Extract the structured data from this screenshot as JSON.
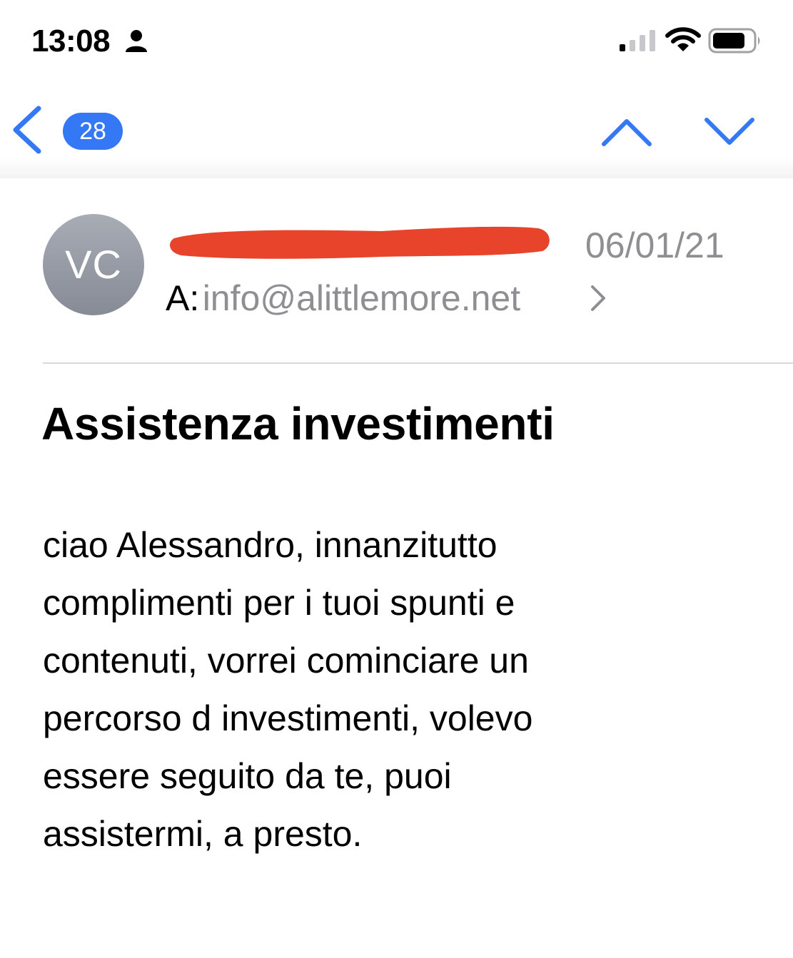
{
  "status_bar": {
    "time": "13:08",
    "icons": [
      "person-icon",
      "signal-icon",
      "wifi-icon",
      "battery-icon"
    ]
  },
  "nav": {
    "back_icon": "chevron-left-icon",
    "unread_count": "28",
    "prev_icon": "chevron-up-icon",
    "next_icon": "chevron-down-icon",
    "accent_color": "#3478f6"
  },
  "message": {
    "avatar_initials": "VC",
    "sender_name": "",
    "date": "06/01/21",
    "recipient_prefix": "A:",
    "recipient_address": "info@alittlemore.net",
    "subject": "Assistenza investimenti",
    "body_lines": [
      "ciao Alessandro, innanzitutto",
      "complimenti per i tuoi spunti e",
      "contenuti, vorrei cominciare un",
      "percorso d investimenti, volevo",
      "essere seguito da te, puoi",
      "assistermi, a presto."
    ]
  }
}
